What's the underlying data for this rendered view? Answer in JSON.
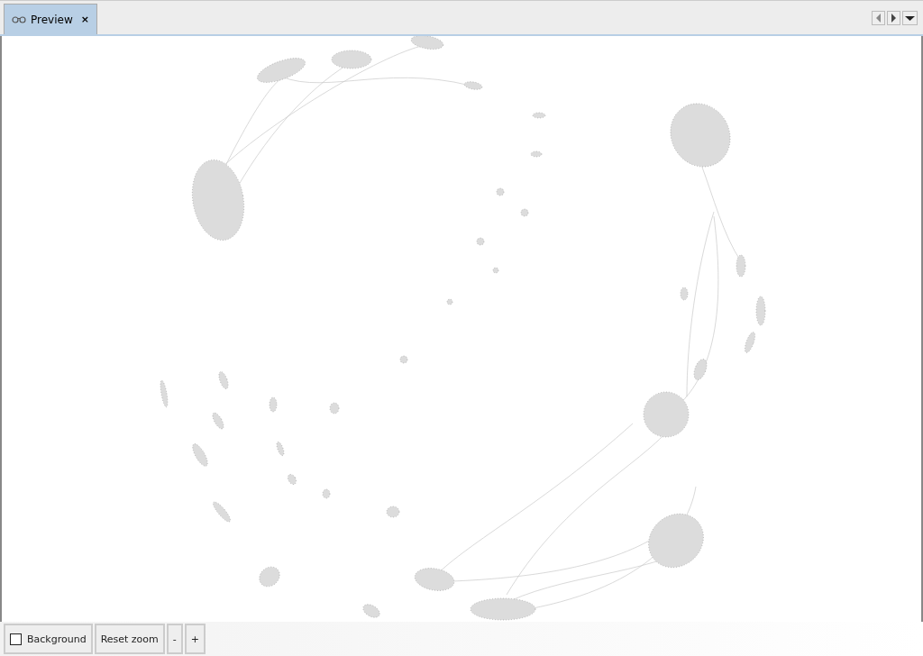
{
  "tabs": [
    {
      "label": "Preview",
      "close": "×",
      "selected": true
    }
  ],
  "toolbar": {
    "buttons": [
      {
        "kind": "swatch",
        "label": "Background"
      },
      {
        "kind": "plain",
        "label": "Reset zoom"
      },
      {
        "kind": "plain",
        "label": "-"
      },
      {
        "kind": "plain",
        "label": "+"
      }
    ]
  }
}
